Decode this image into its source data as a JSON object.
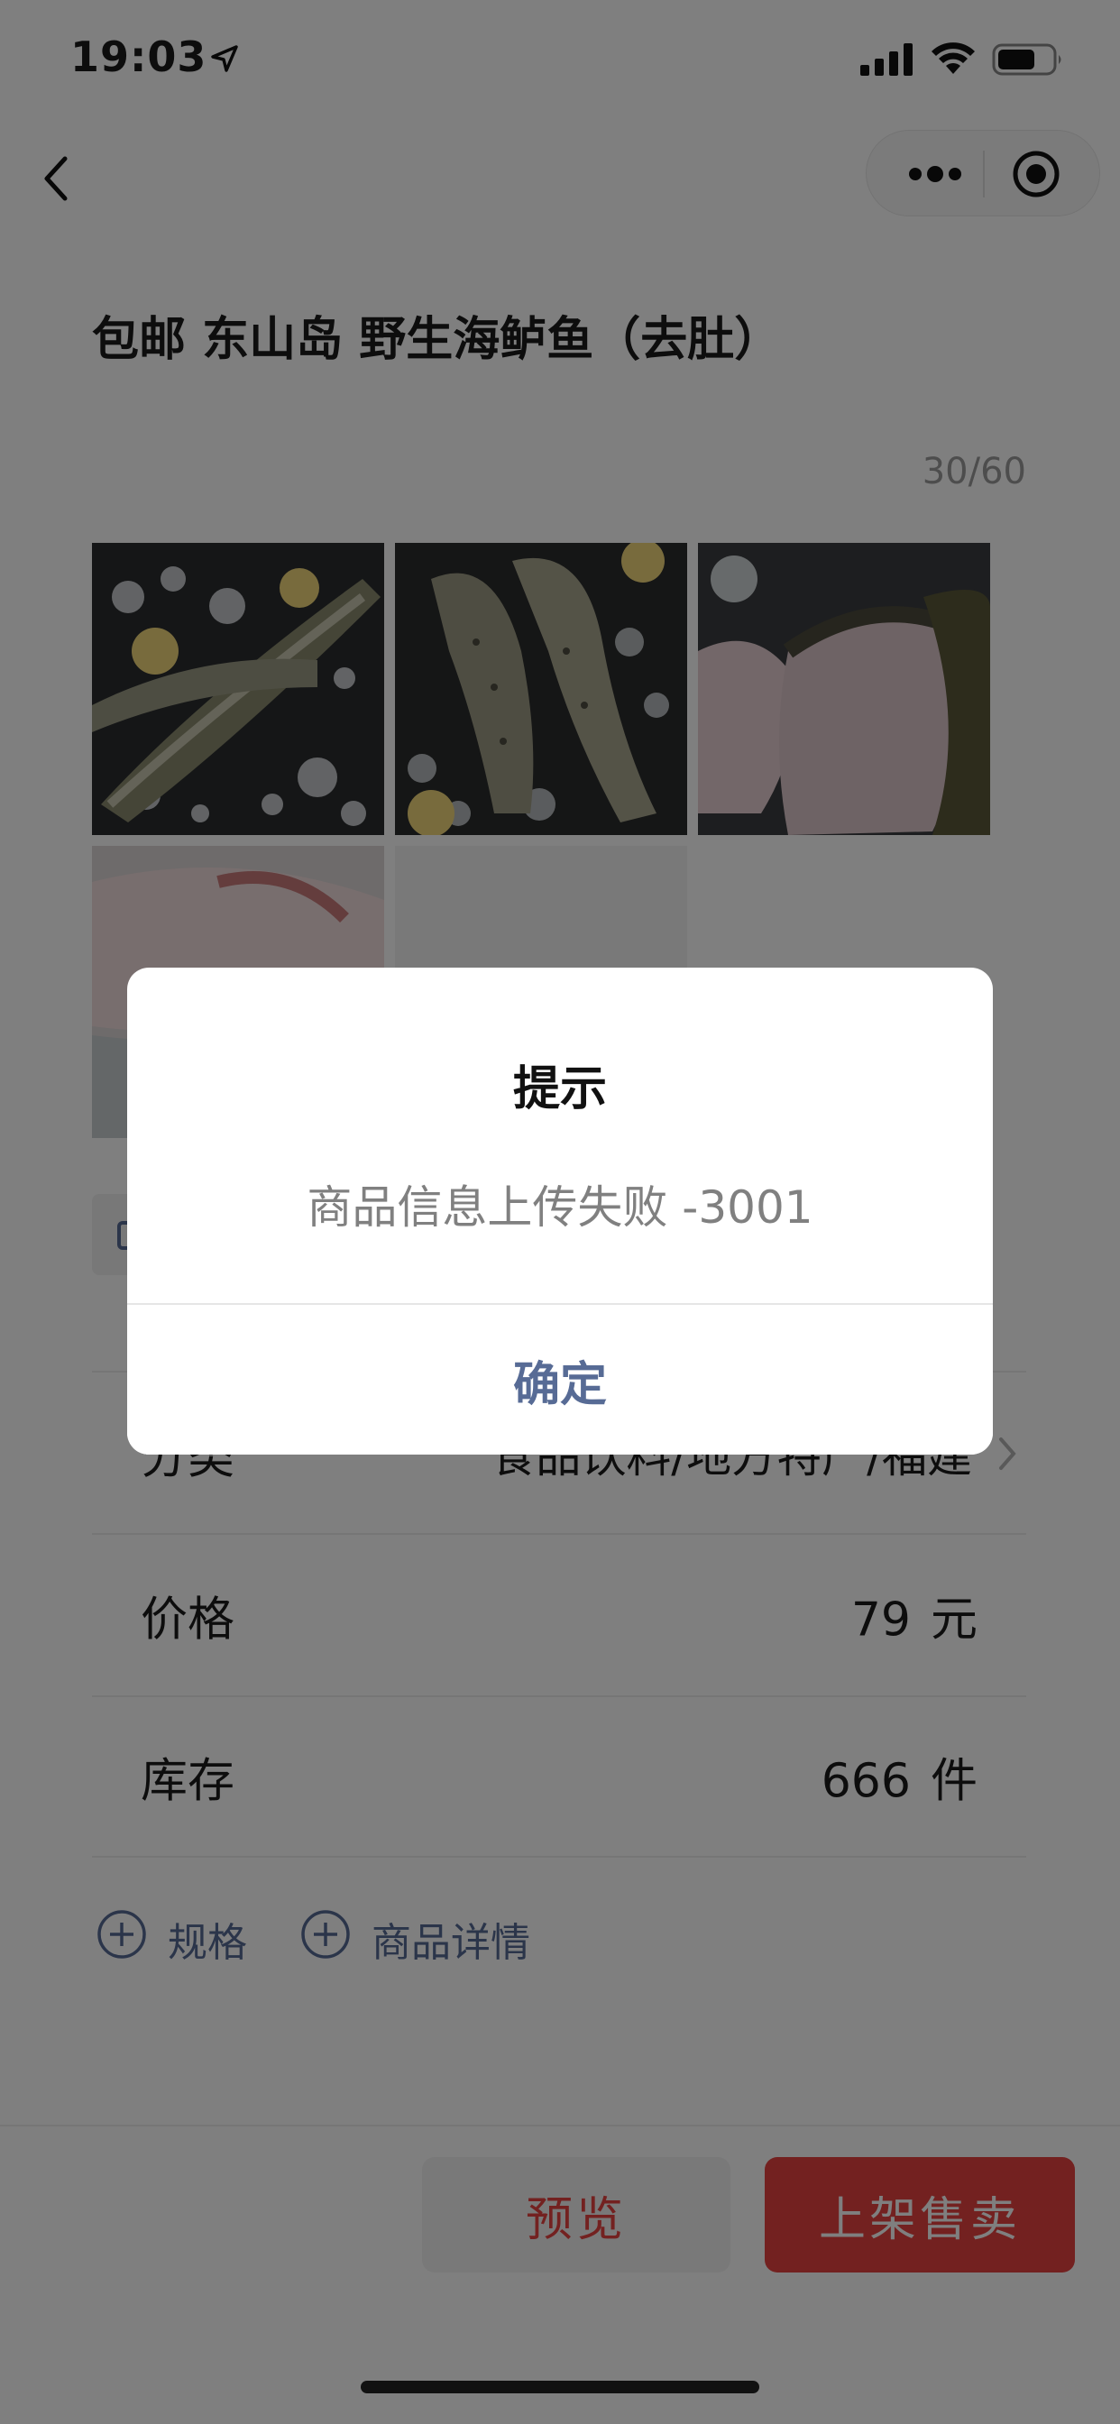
{
  "status_bar": {
    "time": "19:03"
  },
  "product": {
    "title": "包邮 东山岛 野生海鲈鱼（去肚）",
    "char_count": "30/60"
  },
  "photos": [
    {
      "icon": "fish-photo"
    },
    {
      "icon": "fish-photo"
    },
    {
      "icon": "fish-steak-photo"
    },
    {
      "icon": "fish-fillet-photo"
    }
  ],
  "form": {
    "category": {
      "label": "分类",
      "value": "食品饮料/地方特产/福建"
    },
    "price": {
      "label": "价格",
      "value": "79",
      "unit": "元"
    },
    "stock": {
      "label": "库存",
      "value": "666",
      "unit": "件"
    }
  },
  "links": {
    "add_spec": "规格",
    "add_detail": "商品详情"
  },
  "buttons": {
    "preview": "预览",
    "publish": "上架售卖"
  },
  "dialog": {
    "title": "提示",
    "message": "商品信息上传失败 -3001",
    "confirm": "确定"
  },
  "colors": {
    "accent_red": "#e64340",
    "link_blue": "#576b95",
    "mask": "rgba(0,0,0,0.5)"
  }
}
